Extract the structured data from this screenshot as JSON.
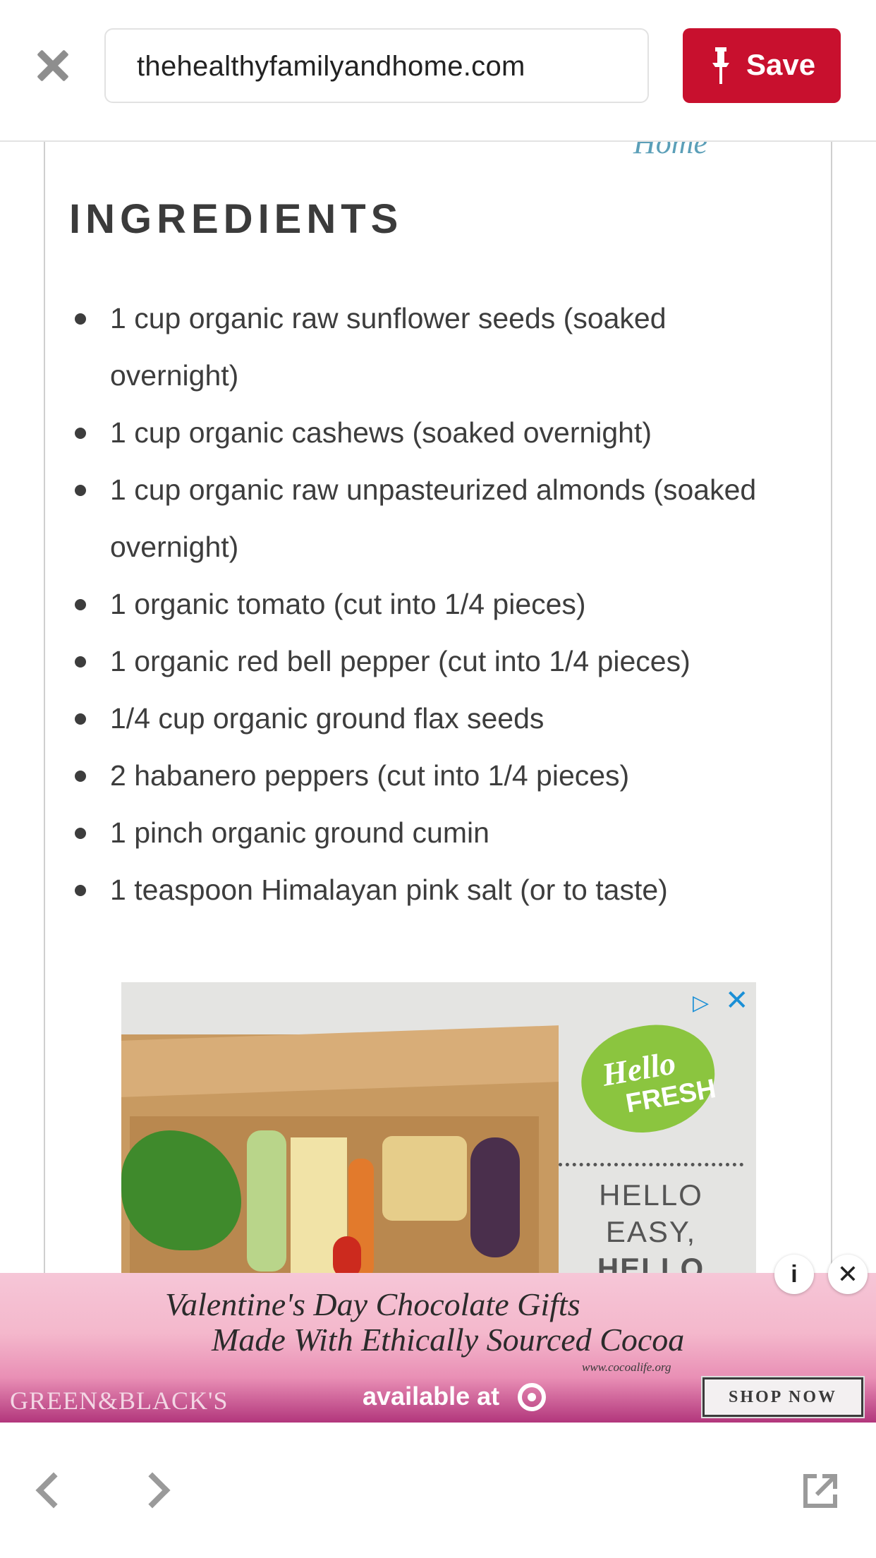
{
  "topbar": {
    "url": "thehealthyfamilyandhome.com",
    "save_label": "Save"
  },
  "article": {
    "home_link": "Home",
    "heading": "INGREDIENTS",
    "ingredients": [
      "1 cup organic raw sunflower seeds (soaked overnight)",
      "1 cup organic cashews (soaked overnight)",
      "1 cup organic raw unpasteurized almonds (soaked overnight)",
      "1 organic tomato (cut into 1/4 pieces)",
      "1 organic red bell pepper (cut into 1/4 pieces)",
      "1/4 cup organic ground flax seeds",
      "2 habanero peppers (cut into 1/4 pieces)",
      "1 pinch organic ground cumin",
      "1 teaspoon Himalayan pink salt (or to taste)"
    ]
  },
  "ad_hellofresh": {
    "logo_line1": "Hello",
    "logo_line2": "FRESH",
    "tagline1": "HELLO",
    "tagline2": "EASY,",
    "tagline3": "HELLO",
    "close_glyph": "✕",
    "adchoices_glyph": "▷"
  },
  "banner_ad": {
    "line1": "Valentine's Day Chocolate Gifts",
    "line2": "Made With Ethically Sourced Cocoa",
    "small_url": "www.cocoalife.org",
    "brand": "GREEN&BLACK'S",
    "available": "available at",
    "shop_now": "SHOP NOW",
    "info_glyph": "i",
    "close_glyph": "✕"
  },
  "icons": {
    "close": "close-icon",
    "pin": "pin-icon",
    "back": "chevron-left-icon",
    "forward": "chevron-right-icon",
    "open_external": "open-external-icon"
  },
  "colors": {
    "save_red": "#c8102e",
    "home_link_blue": "#5b9fb8",
    "hellofresh_green": "#8bc53f",
    "banner_pink": "#f4b8cc"
  }
}
